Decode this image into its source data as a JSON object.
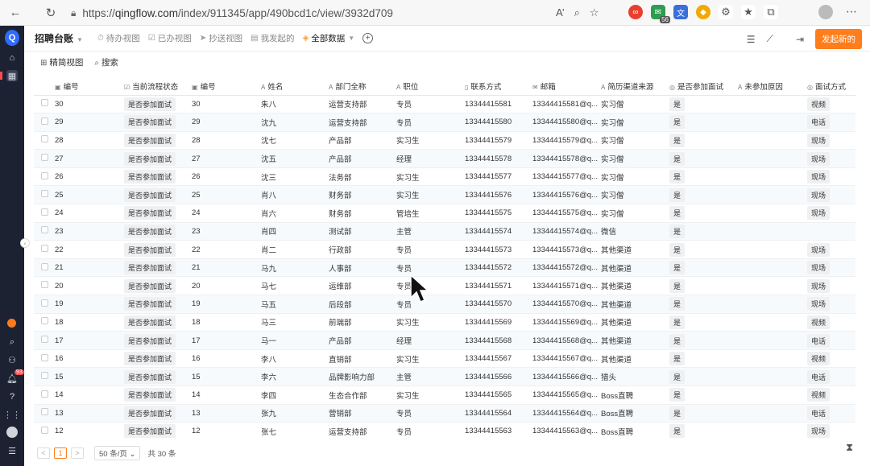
{
  "browser": {
    "url_protocol": "https://",
    "url_host": "qingflow.com",
    "url_path": "/index/911345/app/490bcd1c/view/3932d709",
    "reader_label": "A’",
    "ext_badge": "56"
  },
  "nav": {
    "logo": "Q",
    "badge": "93"
  },
  "header": {
    "app_title": "招聘台账",
    "views": [
      {
        "label": "待办视图",
        "icon": "⏱"
      },
      {
        "label": "已办视图",
        "icon": "☑"
      },
      {
        "label": "抄送视图",
        "icon": "➤"
      },
      {
        "label": "我发起的",
        "icon": "▤"
      },
      {
        "label": "全部数据",
        "icon": "◈"
      }
    ],
    "launch_label": "发起新的"
  },
  "toolbar": {
    "simple_view": "精简视图",
    "search": "搜索"
  },
  "table": {
    "columns": [
      "编号",
      "当前流程状态",
      "编号",
      "姓名",
      "部门全称",
      "职位",
      "联系方式",
      "邮箱",
      "简历渠道来源",
      "是否参加面试",
      "未参加原因",
      "面试方式"
    ],
    "rows": [
      [
        "30",
        "是否参加面试",
        "30",
        "朱八",
        "运营支持部",
        "专员",
        "13344415581",
        "13344415581@q...",
        "实习僧",
        "是",
        "",
        "视频"
      ],
      [
        "29",
        "是否参加面试",
        "29",
        "沈九",
        "运营支持部",
        "专员",
        "13344415580",
        "13344415580@q...",
        "实习僧",
        "是",
        "",
        "电话"
      ],
      [
        "28",
        "是否参加面试",
        "28",
        "沈七",
        "产品部",
        "实习生",
        "13344415579",
        "13344415579@q...",
        "实习僧",
        "是",
        "",
        "现场"
      ],
      [
        "27",
        "是否参加面试",
        "27",
        "沈五",
        "产品部",
        "经理",
        "13344415578",
        "13344415578@q...",
        "实习僧",
        "是",
        "",
        "现场"
      ],
      [
        "26",
        "是否参加面试",
        "26",
        "沈三",
        "法务部",
        "实习生",
        "13344415577",
        "13344415577@q...",
        "实习僧",
        "是",
        "",
        "现场"
      ],
      [
        "25",
        "是否参加面试",
        "25",
        "肖八",
        "财务部",
        "实习生",
        "13344415576",
        "13344415576@q...",
        "实习僧",
        "是",
        "",
        "现场"
      ],
      [
        "24",
        "是否参加面试",
        "24",
        "肖六",
        "财务部",
        "管培生",
        "13344415575",
        "13344415575@q...",
        "实习僧",
        "是",
        "",
        "现场"
      ],
      [
        "23",
        "是否参加面试",
        "23",
        "肖四",
        "测试部",
        "主管",
        "13344415574",
        "13344415574@q...",
        "微信",
        "是",
        "",
        ""
      ],
      [
        "22",
        "是否参加面试",
        "22",
        "肖二",
        "行政部",
        "专员",
        "13344415573",
        "13344415573@q...",
        "其他渠道",
        "是",
        "",
        "现场"
      ],
      [
        "21",
        "是否参加面试",
        "21",
        "马九",
        "人事部",
        "专员",
        "13344415572",
        "13344415572@q...",
        "其他渠道",
        "是",
        "",
        "现场"
      ],
      [
        "20",
        "是否参加面试",
        "20",
        "马七",
        "运维部",
        "专员",
        "13344415571",
        "13344415571@q...",
        "其他渠道",
        "是",
        "",
        "现场"
      ],
      [
        "19",
        "是否参加面试",
        "19",
        "马五",
        "后段部",
        "专员",
        "13344415570",
        "13344415570@q...",
        "其他渠道",
        "是",
        "",
        "现场"
      ],
      [
        "18",
        "是否参加面试",
        "18",
        "马三",
        "前端部",
        "实习生",
        "13344415569",
        "13344415569@q...",
        "其他渠道",
        "是",
        "",
        "视频"
      ],
      [
        "17",
        "是否参加面试",
        "17",
        "马一",
        "产品部",
        "经理",
        "13344415568",
        "13344415568@q...",
        "其他渠道",
        "是",
        "",
        "电话"
      ],
      [
        "16",
        "是否参加面试",
        "16",
        "李八",
        "直销部",
        "实习生",
        "13344415567",
        "13344415567@q...",
        "其他渠道",
        "是",
        "",
        "视频"
      ],
      [
        "15",
        "是否参加面试",
        "15",
        "李六",
        "品牌影响力部",
        "主管",
        "13344415566",
        "13344415566@q...",
        "猎头",
        "是",
        "",
        "电话"
      ],
      [
        "14",
        "是否参加面试",
        "14",
        "李四",
        "生态合作部",
        "实习生",
        "13344415565",
        "13344415565@q...",
        "Boss直聘",
        "是",
        "",
        "视频"
      ],
      [
        "13",
        "是否参加面试",
        "13",
        "张九",
        "营销部",
        "专员",
        "13344415564",
        "13344415564@q...",
        "Boss直聘",
        "是",
        "",
        "电话"
      ],
      [
        "12",
        "是否参加面试",
        "12",
        "张七",
        "运营支持部",
        "专员",
        "13344415563",
        "13344415563@q...",
        "Boss直聘",
        "是",
        "",
        "现场"
      ]
    ]
  },
  "pager": {
    "prev": "<",
    "current": "1",
    "next": ">",
    "page_size": "50 条/页",
    "page_size_caret": "⌄",
    "total": "共 30 条"
  }
}
